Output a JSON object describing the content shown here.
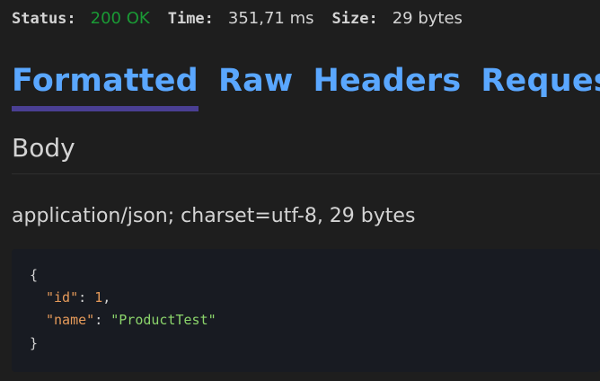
{
  "status_bar": {
    "status_label": "Status:",
    "status_value": "200 OK",
    "time_label": "Time:",
    "time_value": "351,71 ms",
    "size_label": "Size:",
    "size_value": "29 bytes",
    "colors": {
      "ok": "#1a9a35"
    }
  },
  "tabs": [
    {
      "label": "Formatted",
      "active": true
    },
    {
      "label": "Raw",
      "active": false
    },
    {
      "label": "Headers",
      "active": false
    },
    {
      "label": "Request",
      "active": false
    }
  ],
  "body": {
    "title": "Body",
    "content_type": "application/json; charset=utf-8, 29 bytes",
    "code": {
      "open_brace": "{",
      "lines": [
        {
          "key": "\"id\"",
          "sep": ": ",
          "value": "1",
          "value_type": "number",
          "trail": ","
        },
        {
          "key": "\"name\"",
          "sep": ": ",
          "value": "\"ProductTest\"",
          "value_type": "string",
          "trail": ""
        }
      ],
      "close_brace": "}"
    }
  },
  "accent": {
    "tab_text": "#5aa7ff",
    "tab_underline": "#4a3f93"
  }
}
